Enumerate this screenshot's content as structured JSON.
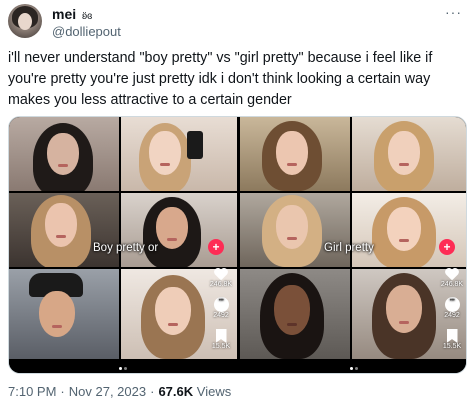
{
  "user": {
    "display_name": "mei",
    "name_icon": "ʚ̈ɞ",
    "handle": "@dolliepout",
    "more_icon": "···"
  },
  "tweet": {
    "text": "i'll never understand \"boy pretty\" vs \"girl pretty\" because i feel like if you're pretty you're just pretty idk i don't think looking a certain way makes you less attractive to a certain gender"
  },
  "media": {
    "left": {
      "overlay_label": "Boy pretty or",
      "likes": "246.8K",
      "comments": "2492",
      "saves": "15.5K"
    },
    "right": {
      "overlay_label": "Girl pretty",
      "likes": "246.8K",
      "comments": "2492",
      "saves": "15.5K"
    }
  },
  "meta": {
    "time": "7:10 PM",
    "date": "Nov 27, 2023",
    "separator": "·",
    "views_count": "67.6K",
    "views_label": "Views"
  },
  "colors": {
    "text": "#0f1419",
    "secondary": "#536471",
    "tiktok_red": "#fe2c55"
  }
}
